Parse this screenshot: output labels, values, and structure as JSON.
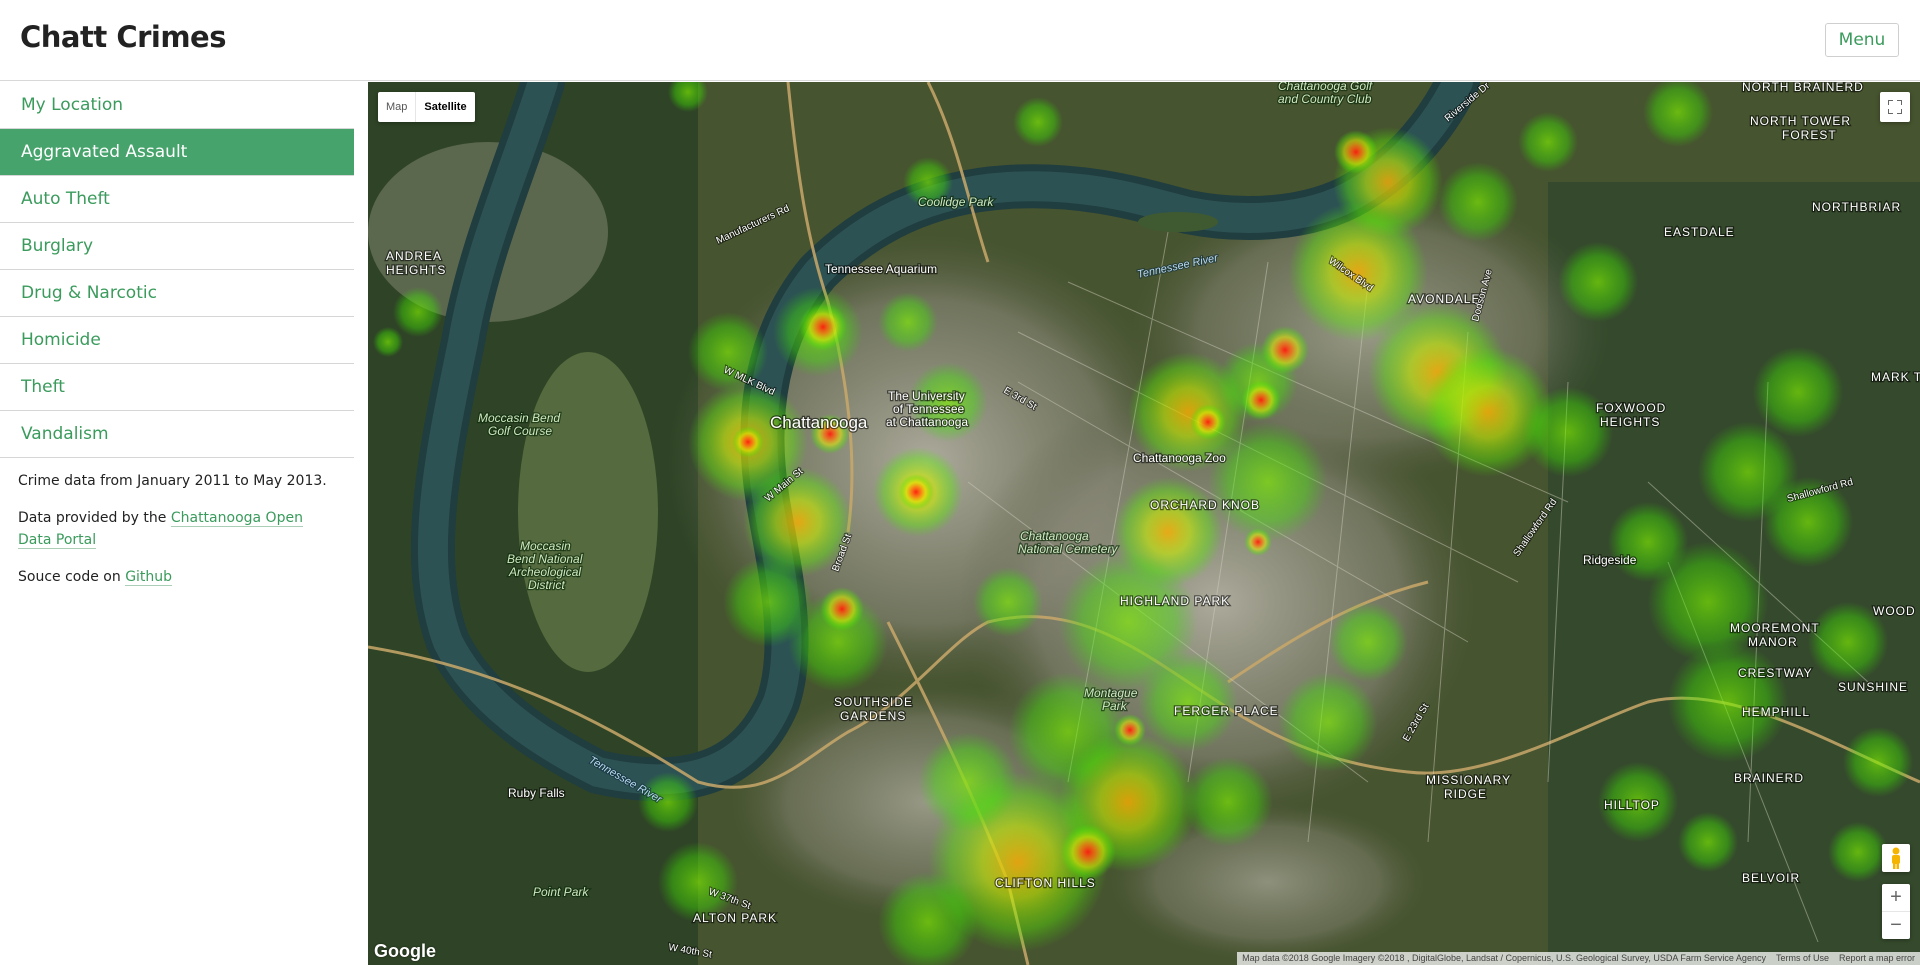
{
  "header": {
    "title": "Chatt Crimes",
    "menu_label": "Menu"
  },
  "sidebar": {
    "items": [
      {
        "label": "My Location",
        "active": false
      },
      {
        "label": "Aggravated Assault",
        "active": true
      },
      {
        "label": "Auto Theft",
        "active": false
      },
      {
        "label": "Burglary",
        "active": false
      },
      {
        "label": "Drug & Narcotic",
        "active": false
      },
      {
        "label": "Homicide",
        "active": false
      },
      {
        "label": "Theft",
        "active": false
      },
      {
        "label": "Vandalism",
        "active": false
      }
    ],
    "info": {
      "date_range": "Crime data from January 2011 to May 2013.",
      "provided_prefix": "Data provided by the ",
      "provided_link": "Chattanooga Open Data Portal",
      "source_prefix": "Souce code on ",
      "source_link": "Github"
    }
  },
  "map": {
    "map_type": {
      "map_label": "Map",
      "satellite_label": "Satellite",
      "selected": "Satellite"
    },
    "zoom": {
      "in": "+",
      "out": "−"
    },
    "logo": "Google",
    "attribution": {
      "data": "Map data ©2018 Google Imagery ©2018 , DigitalGlobe, Landsat / Copernicus, U.S. Geological Survey, USDA Farm Service Agency",
      "terms": "Terms of Use",
      "report": "Report a map error"
    },
    "labels": {
      "chattanooga": "Chattanooga",
      "aquarium": "Tennessee Aquarium",
      "utc_1": "The University",
      "utc_2": "of Tennessee",
      "utc_3": "at Chattanooga",
      "zoo": "Chattanooga Zoo",
      "natl_cem_1": "Chattanooga",
      "natl_cem_2": "National Cemetery",
      "coolidge": "Coolidge Park",
      "golf_1": "Chattanooga Golf",
      "golf_2": "and Country Club",
      "moccasin_golf_1": "Moccasin Bend",
      "moccasin_golf_2": "Golf Course",
      "moccasin_arch_1": "Moccasin",
      "moccasin_arch_2": "Bend National",
      "moccasin_arch_3": "Archeological",
      "moccasin_arch_4": "District",
      "montague_1": "Montague",
      "montague_2": "Park",
      "ruby_falls": "Ruby Falls",
      "point_park": "Point Park",
      "river": "Tennessee River",
      "andrea_1": "ANDREA",
      "andrea_2": "HEIGHTS",
      "avondale": "AVONDALE",
      "orchard_knob": "ORCHARD KNOB",
      "highland_park": "HIGHLAND PARK",
      "ferger_place": "FERGER PLACE",
      "southside_1": "SOUTHSIDE",
      "southside_2": "GARDENS",
      "missionary_1": "MISSIONARY",
      "missionary_2": "RIDGE",
      "clifton_hills": "CLIFTON HILLS",
      "alton_park": "ALTON PARK",
      "eastdale": "EASTDALE",
      "north_brainerd": "NORTH BRAINERD",
      "north_tower_1": "NORTH TOWER",
      "north_tower_2": "FOREST",
      "northbriar": "NORTHBRIAR",
      "foxwood_1": "FOXWOOD",
      "foxwood_2": "HEIGHTS",
      "mark_twain": "MARK TWA",
      "mooremont_1": "MOOREMONT",
      "mooremont_2": "MANOR",
      "crestway": "CRESTWAY",
      "hemphill": "HEMPHILL",
      "sunshine": "SUNSHINE",
      "brainerd": "BRAINERD",
      "hilltop": "HILLTOP",
      "belvoir": "BELVOIR",
      "ridgeside": "Ridgeside",
      "wood": "WOOD",
      "manufacturers_rd": "Manufacturers Rd",
      "riverside_dr": "Riverside Dr",
      "shallowford_rd": "Shallowford Rd",
      "wilcox_blvd": "Wilcox Blvd",
      "dodson_ave": "Dodson Ave",
      "e_3rd_st": "E 3rd St",
      "broad_st": "Broad St",
      "w_main_st": "W Main St",
      "mlk_blvd": "W MLK Blvd",
      "e_23rd_st": "E 23rd St",
      "w_37th_st": "W 37th St",
      "w_40th_st": "W 40th St"
    }
  }
}
